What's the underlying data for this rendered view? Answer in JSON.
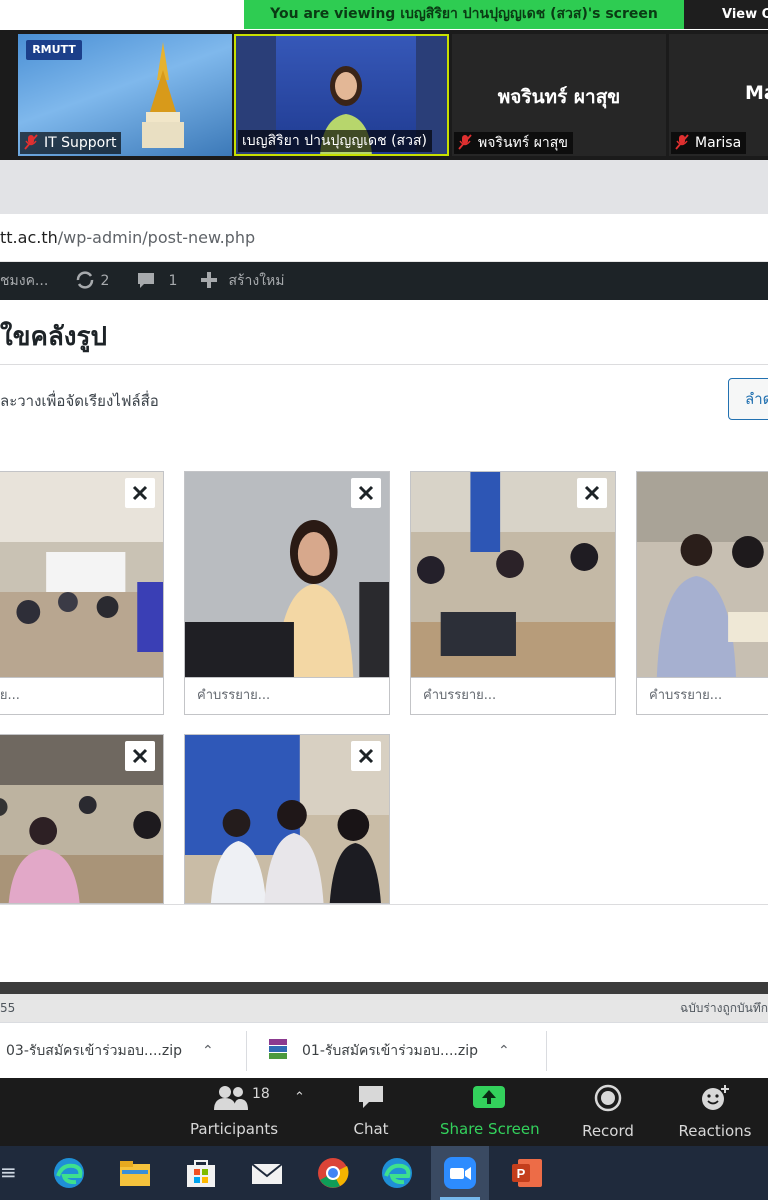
{
  "zoom": {
    "banner_text": "You are viewing เบญสิริยา ปานปุญญเดช (สวส)'s screen",
    "view_options_label": "View O",
    "participants": [
      {
        "tile_label": "IT Support",
        "logo_text": "RMUTT",
        "big_name": ""
      },
      {
        "tile_label": "เบญสิริยา ปานปุญญเดช (สวส)",
        "big_name": ""
      },
      {
        "tile_label": "พจรินทร์ ผาสุข",
        "big_name": "พจรินทร์ ผาสุข"
      },
      {
        "tile_label": "Marisa",
        "big_name": "Ma"
      }
    ],
    "toolbar": {
      "participants_label": "Participants",
      "participants_count": "18",
      "chat_label": "Chat",
      "share_label": "Share Screen",
      "record_label": "Record",
      "reactions_label": "Reactions"
    },
    "colors": {
      "share_green": "#33d15c",
      "banner_green": "#2ecc52"
    }
  },
  "browser": {
    "url_host": "tt.ac.th",
    "url_path": "/wp-admin/post-new.php"
  },
  "wp_adminbar": {
    "site_name": "ชมงค...",
    "views_count": "2",
    "comments_count": "1",
    "new_label": "สร้างใหม่"
  },
  "gallery_modal": {
    "title": "ใขคลังรูป",
    "instruction": "ละวางเพื่อจัดเรียงไฟล์สื่อ",
    "reverse_button": "ลำด",
    "caption_placeholders": [
      "รรยาย...",
      "คำบรรยาย...",
      "คำบรรยาย...",
      "คำบรรยาย..."
    ]
  },
  "editor_footer": {
    "word_count": "55",
    "draft_status": "ฉบับร่างถูกบันทึก"
  },
  "downloads": [
    {
      "filename": "03-รับสมัครเข้าร่วมอบ....zip"
    },
    {
      "filename": "01-รับสมัครเข้าร่วมอบ....zip"
    }
  ],
  "taskbar": {
    "apps": [
      "edge-icon",
      "file-explorer-icon",
      "microsoft-store-icon",
      "mail-icon",
      "chrome-icon",
      "edge-icon",
      "zoom-icon",
      "powerpoint-icon"
    ]
  }
}
